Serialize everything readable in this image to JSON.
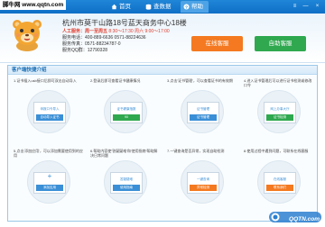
{
  "window": {
    "watermark": "脚牛网 www.qqtn.com",
    "tabs": [
      {
        "label": "首页",
        "icon": "home-icon",
        "active": false
      },
      {
        "label": "查数据",
        "icon": "database-icon",
        "active": false
      },
      {
        "label": "帮助",
        "icon": "help-icon",
        "active": true
      }
    ],
    "controls": {
      "menu": "≡",
      "minimize": "—",
      "close": "×"
    }
  },
  "header": {
    "address": "杭州市莫干山路18号蓝天商务中心18楼",
    "service_label": "人工服务：",
    "service_days": "周一至周五",
    "service_hours": "8:30～17:30 周六 9:00～17:00",
    "phone_label": "服务电话：",
    "phone_value": "400-889-6636  0571-88224636",
    "fax_label": "服务传真：",
    "fax_value": "0571-88234787-0",
    "qq_label": "服务QQ群：",
    "qq_value": "12790328",
    "online_button": "在线客服",
    "self_button": "自助客服"
  },
  "intro": {
    "title": "客户端快捷介绍",
    "steps": [
      {
        "text": "1.证书插入usb接口后即可双击自动导入",
        "mini_top": "申报口令导入",
        "mini_btn": "自动导入证书"
      },
      {
        "text": "2.登录后即可查看证书健康情况",
        "mini_top": "证书健康指数",
        "mini_btn": "90"
      },
      {
        "text": "3.点击'证书管理'，可以查看证书的有效期",
        "mini_top": "证书管理",
        "mini_btn": "证书管理"
      },
      {
        "text": "4.进入证书管理后可以进行证书检测或修改口令",
        "mini_top": "网上办事大厅",
        "mini_btn": "证书检测"
      },
      {
        "text": "5.点击'添加应用'，可以添加需要使用到的应用",
        "mini_top": "+",
        "mini_btn": "添加应用"
      },
      {
        "text": "6.帮助内容使'答疑疑难'和'使用指南'帮助解决日常问题",
        "mini_top": "答疑疑难",
        "mini_btn": "使用指南"
      },
      {
        "text": "7.一键查询是否异常，实现自助检测",
        "mini_top": "一键查询",
        "mini_btn": "异常检测"
      },
      {
        "text": "8.使用过程中遇到问题，可联系在线客服",
        "mini_top": "在线客服",
        "mini_btn": "联系我们"
      }
    ]
  },
  "logo": {
    "text": "QQTN.com"
  },
  "colors": {
    "titlebar": "#1f86d8",
    "orange": "#f47920",
    "green": "#2fa84f",
    "accent_blue": "#3b8fd6",
    "red": "#e03c2c"
  }
}
